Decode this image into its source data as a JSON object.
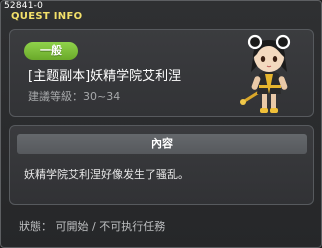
{
  "window": {
    "quest_id": "52841-0",
    "title": "QUEST INFO"
  },
  "quest": {
    "category": "一般",
    "name": "[主题副本]妖精学院艾利涅",
    "level_label": "建議等級",
    "level_range": "30~34",
    "npc_icon": "npc-girl-portrait"
  },
  "content": {
    "header": "內容",
    "text": "妖精学院艾利涅好像发生了骚乱。"
  },
  "status": {
    "label": "狀態",
    "available": "可開始",
    "separator": "/",
    "unavailable": "不可执行任務"
  },
  "colors": {
    "title": "#f2e06a",
    "badge": "#7fbf3a",
    "panel": "#37383b",
    "border": "#575a5e"
  }
}
